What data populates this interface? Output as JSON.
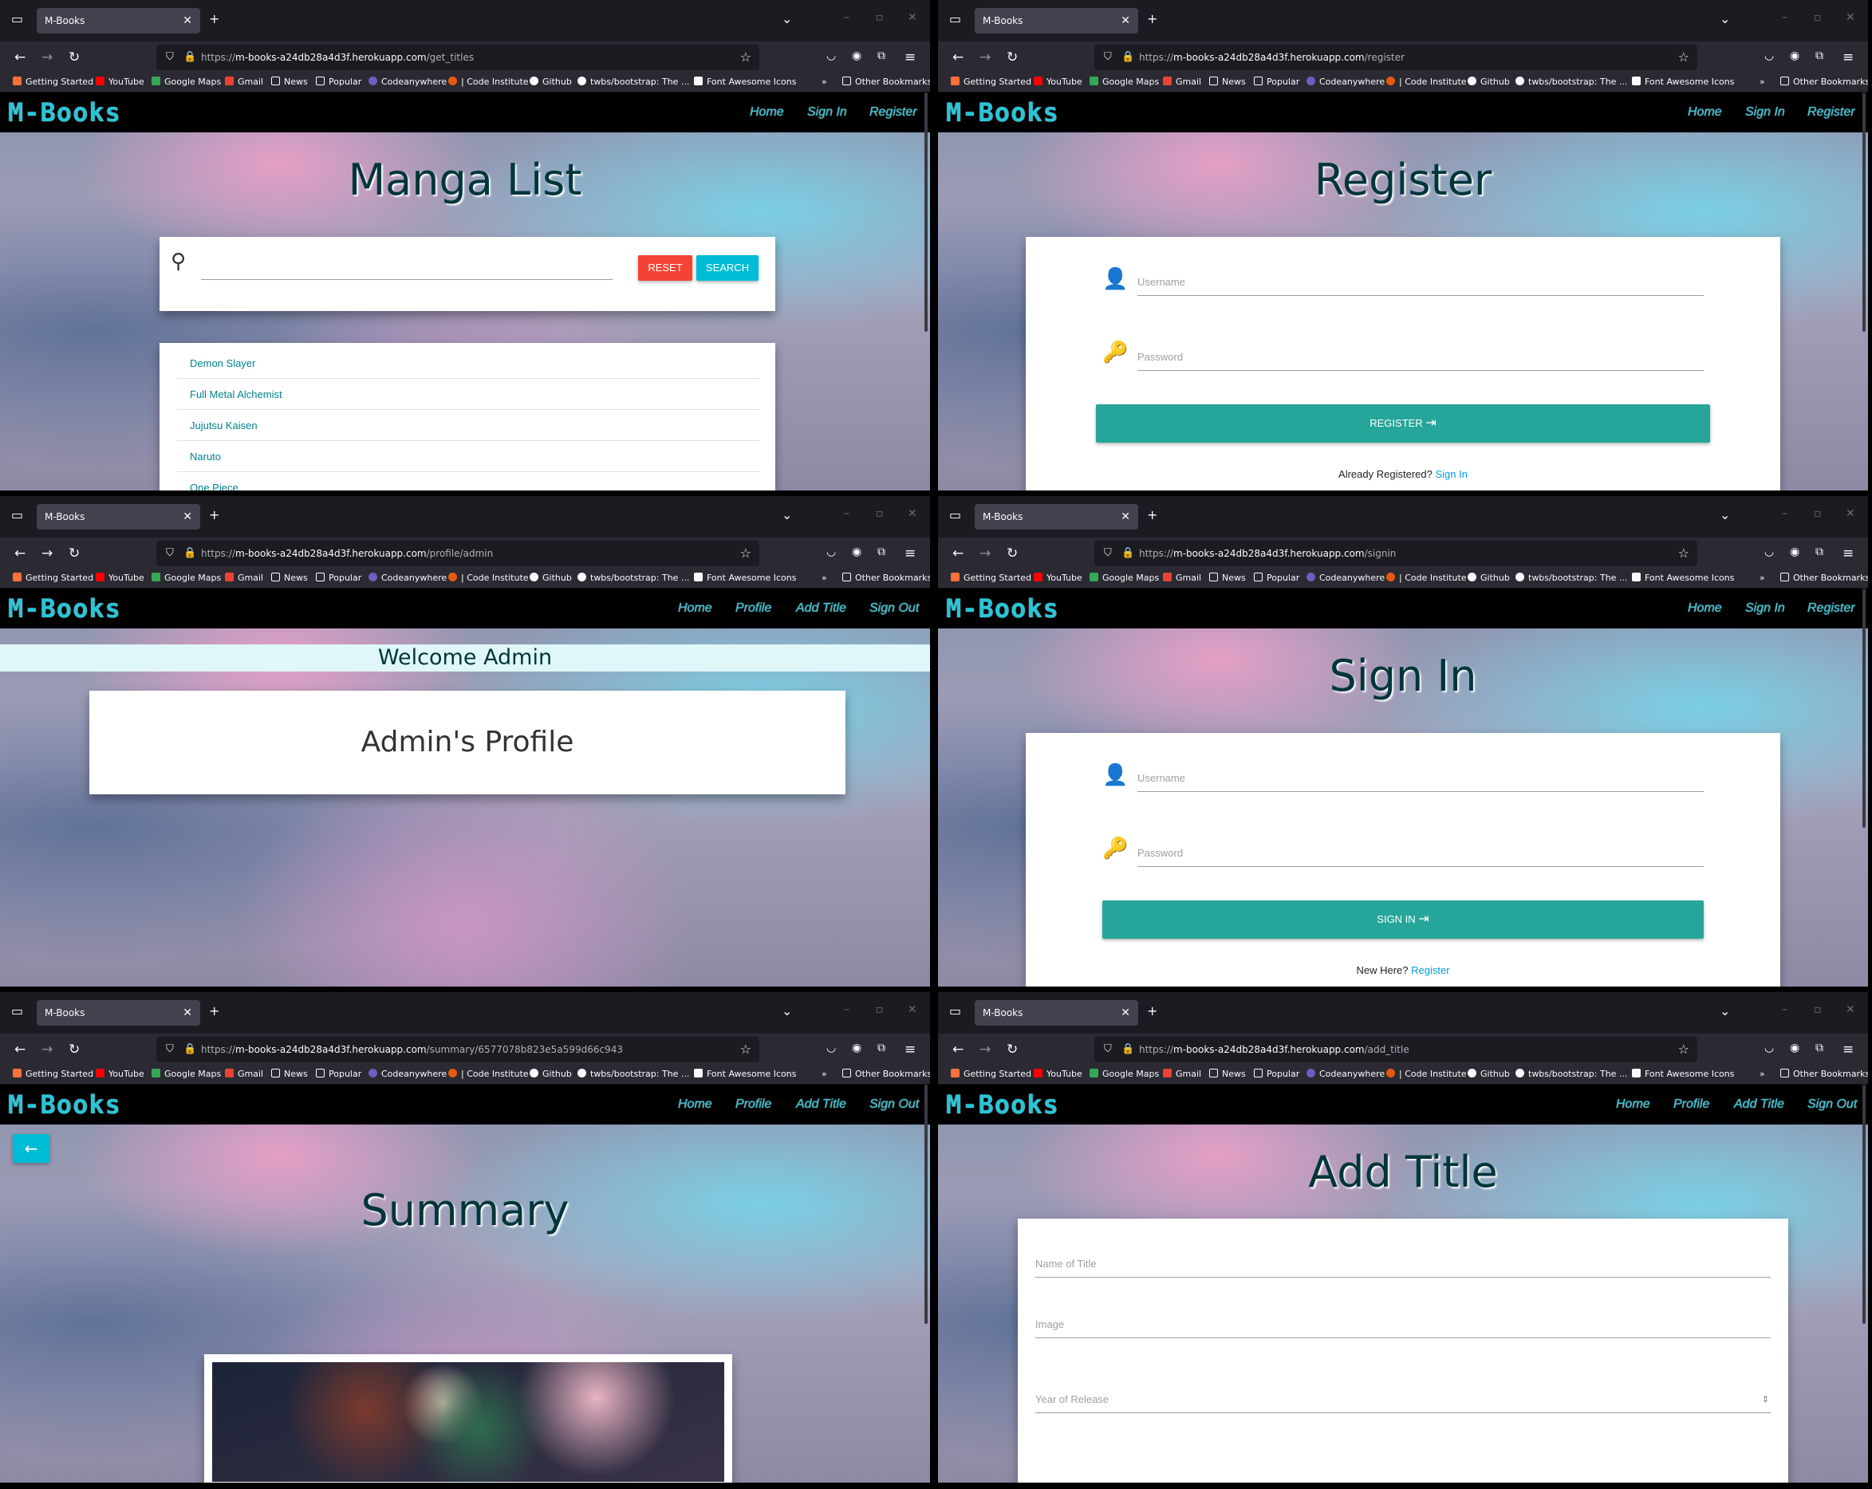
{
  "browser": {
    "tab_title": "M-Books",
    "domain": "m-books-a24db28a4d3f.herokuapp.com",
    "bookmarks": [
      "Getting Started",
      "YouTube",
      "Google Maps",
      "Gmail",
      "News",
      "Popular",
      "Codeanywhere",
      "| Code Institute",
      "Github",
      "twbs/bootstrap: The ...",
      "Font Awesome Icons"
    ],
    "other_bookmarks": "Other Bookmarks"
  },
  "app": {
    "logo": "M-Books",
    "nav_guest": [
      "Home",
      "Sign In",
      "Register"
    ],
    "nav_user": [
      "Home",
      "Profile",
      "Add Title",
      "Sign Out"
    ]
  },
  "screens": {
    "manga_list": {
      "url_prefix": "https://",
      "url_path": "/get_titles",
      "title": "Manga List",
      "reset_label": "RESET",
      "search_label": "SEARCH",
      "titles": [
        "Demon Slayer",
        "Full Metal Alchemist",
        "Jujutsu Kaisen",
        "Naruto",
        "One Piece"
      ]
    },
    "register": {
      "url_prefix": "https://",
      "url_path": "/register",
      "title": "Register",
      "username_placeholder": "Username",
      "password_placeholder": "Password",
      "button_label": "REGISTER",
      "footer_text": "Already Registered?",
      "footer_link": "Sign In"
    },
    "profile": {
      "url_prefix": "https://",
      "url_path": "/profile/admin",
      "welcome": "Welcome Admin",
      "profile_title": "Admin's Profile"
    },
    "signin": {
      "url_prefix": "https://",
      "url_path": "/signin",
      "title": "Sign In",
      "username_placeholder": "Username",
      "password_placeholder": "Password",
      "button_label": "SIGN IN",
      "footer_text": "New Here?",
      "footer_link": "Register"
    },
    "summary": {
      "url_prefix": "https://",
      "url_path": "/summary/6577078b823e5a599d66c943",
      "title": "Summary"
    },
    "add_title": {
      "url_prefix": "https://",
      "url_path": "/add_title",
      "title": "Add Title",
      "fields": [
        "Name of Title",
        "Image",
        "Year of Release"
      ]
    }
  },
  "colors": {
    "brand": "#26c6da",
    "teal_button": "#26a69a",
    "reset_button": "#f44336",
    "search_button": "#00bcd4",
    "link": "#039be5"
  }
}
